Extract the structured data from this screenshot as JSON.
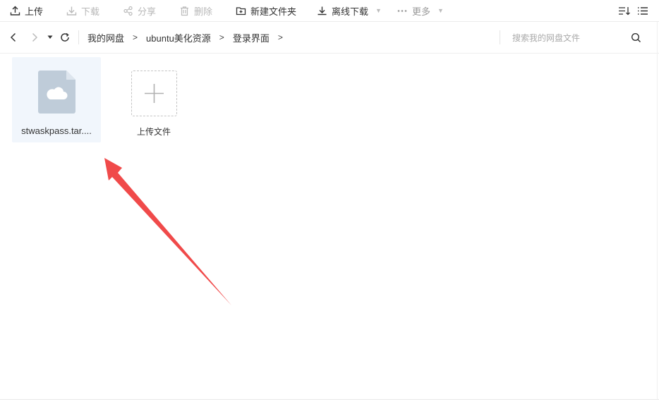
{
  "toolbar": {
    "upload": "上传",
    "download": "下载",
    "share": "分享",
    "delete": "删除",
    "new_folder": "新建文件夹",
    "offline_download": "离线下载",
    "more": "更多"
  },
  "breadcrumb": [
    "我的网盘",
    "ubuntu美化资源",
    "登录界面"
  ],
  "search": {
    "placeholder": "搜索我的网盘文件"
  },
  "files": [
    {
      "name": "stwaskpass.tar...."
    }
  ],
  "upload_tile": {
    "label": "上传文件"
  },
  "colors": {
    "arrow": "#f04a4a",
    "file_selected_bg": "#f1f6fc",
    "file_icon": "#bfccd9"
  }
}
